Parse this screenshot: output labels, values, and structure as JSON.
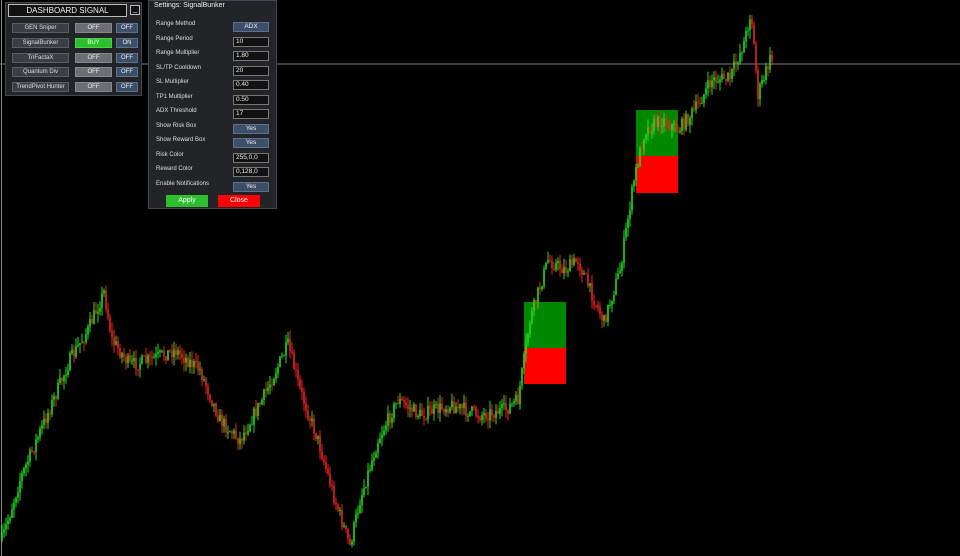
{
  "colors": {
    "background": "#000000",
    "bull": "#22dd22",
    "bear": "#ee2222",
    "reward_box": "#008800",
    "risk_box": "#ff0000",
    "buy": "#2dbf2d"
  },
  "dashboard": {
    "title": "DASHBOARD SIGNAL",
    "minimize": "_",
    "rows": [
      {
        "name": "GEN Sniper",
        "signal": "OFF",
        "toggle": "OFF"
      },
      {
        "name": "SignalBunker",
        "signal": "BUY",
        "toggle": "ON"
      },
      {
        "name": "TriFactaX",
        "signal": "OFF",
        "toggle": "OFF"
      },
      {
        "name": "Quantum Div",
        "signal": "OFF",
        "toggle": "OFF"
      },
      {
        "name": "TrendPivot Hunter",
        "signal": "OFF",
        "toggle": "OFF"
      }
    ]
  },
  "settings": {
    "title": "Settings: SignalBunker",
    "fields": [
      {
        "label": "Range Method",
        "value": "ADX",
        "kind": "button"
      },
      {
        "label": "Range Period",
        "value": "10",
        "kind": "input"
      },
      {
        "label": "Range Multiplier",
        "value": "1.80",
        "kind": "input"
      },
      {
        "label": "SL/TP Cooldown",
        "value": "20",
        "kind": "input"
      },
      {
        "label": "SL Multiplier",
        "value": "0.40",
        "kind": "input"
      },
      {
        "label": "TP1 Multiplier",
        "value": "0.50",
        "kind": "input"
      },
      {
        "label": "ADX Threshold",
        "value": "17",
        "kind": "input"
      },
      {
        "label": "Show Risk Box",
        "value": "Yes",
        "kind": "button"
      },
      {
        "label": "Show Reward Box",
        "value": "Yes",
        "kind": "button"
      },
      {
        "label": "Risk Color",
        "value": "255,0,0",
        "kind": "input"
      },
      {
        "label": "Reward Color",
        "value": "0,128,0",
        "kind": "input"
      },
      {
        "label": "Enable Notifications",
        "value": "Yes",
        "kind": "button"
      }
    ],
    "apply_label": "Apply",
    "close_label": "Close"
  }
}
